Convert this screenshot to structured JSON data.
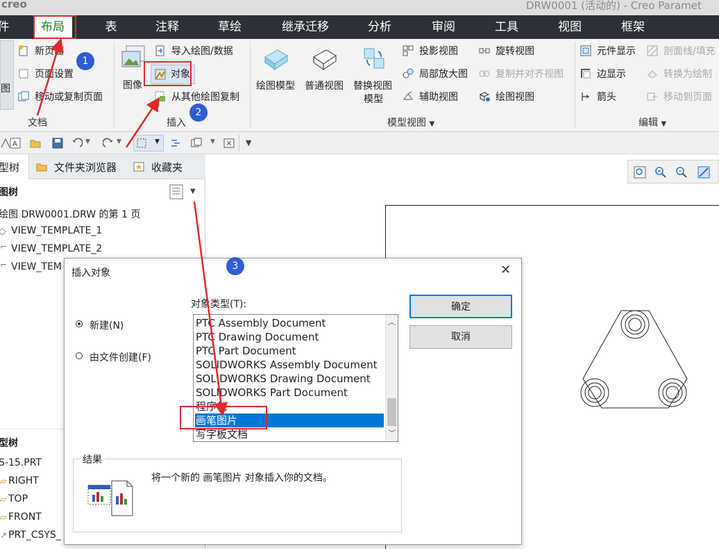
{
  "title": "DRW0001 (活动的) - Creo Paramet",
  "app_logo": "creo",
  "menu": {
    "items": [
      "件",
      "布局",
      "表",
      "注释",
      "草绘",
      "继承迁移",
      "分析",
      "审阅",
      "工具",
      "视图",
      "框架"
    ],
    "active": "布局"
  },
  "ribbon": {
    "doc": {
      "new_page": "新页面",
      "page_setup": "页面设置",
      "move_copy_page": "移动或复制页面",
      "left_cut": "图",
      "group": "文档"
    },
    "insert": {
      "image": "图像",
      "import_drawing": "导入绘图/数据",
      "object": "对象",
      "copy_from_drawing": "从其他绘图复制",
      "group": "插入"
    },
    "model_views": {
      "drawing_model": "绘图模型",
      "general_view": "普通视图",
      "replace_view_model": "替换视图",
      "replace_view_model_2": "模型",
      "projection_view": "投影视图",
      "detail_view": "局部放大图",
      "auxiliary_view": "辅助视图",
      "revolved_view": "旋转视图",
      "copy_align_view": "复制并对齐视图",
      "drawing_view": "绘图视图",
      "group": "模型视图"
    },
    "edit": {
      "component_display": "元件显示",
      "section_line": "剖面线/填充",
      "edge_display": "边显示",
      "convert_to_drawing": "转换为绘制",
      "arrow": "箭头",
      "move_to_page": "移动到页面",
      "group": "编辑"
    }
  },
  "left_panel": {
    "tabs": [
      "型树",
      "文件夹浏览器",
      "收藏夹"
    ],
    "drawing_tree_label": "图树",
    "drawing_tree_items": [
      "绘图 DRW0001.DRW 的第 1 页",
      "VIEW_TEMPLATE_1",
      "VIEW_TEMPLATE_2",
      "VIEW_TEM"
    ],
    "model_tree_label": "型树",
    "model_tree_items": [
      "S-15.PRT",
      "RIGHT",
      "TOP",
      "FRONT",
      "PRT_CSYS_"
    ]
  },
  "dialog": {
    "title": "插入对象",
    "close": "✕",
    "new_label": "新建(N)",
    "from_file_label": "由文件创建(F)",
    "object_type_label": "对象类型(T):",
    "object_types": [
      "PTC Assembly Document",
      "PTC Drawing Document",
      "PTC Part Document",
      "SOLIDWORKS Assembly Document",
      "SOLIDWORKS Drawing Document",
      "SOLIDWORKS Part Document",
      "程序包",
      "画笔图片",
      "写字板文档"
    ],
    "selected_type": "画笔图片",
    "ok": "确定",
    "cancel": "取消",
    "result_label": "结果",
    "result_text": "将一个新的 画笔图片 对象插入你的文档。"
  },
  "annotations": {
    "badge_1": "1",
    "badge_2": "2",
    "badge_3": "3"
  },
  "colors": {
    "menubar": "#2b3137",
    "highlight": "#e02a2a",
    "badge": "#2e5bd6",
    "selection": "#0078d7"
  }
}
